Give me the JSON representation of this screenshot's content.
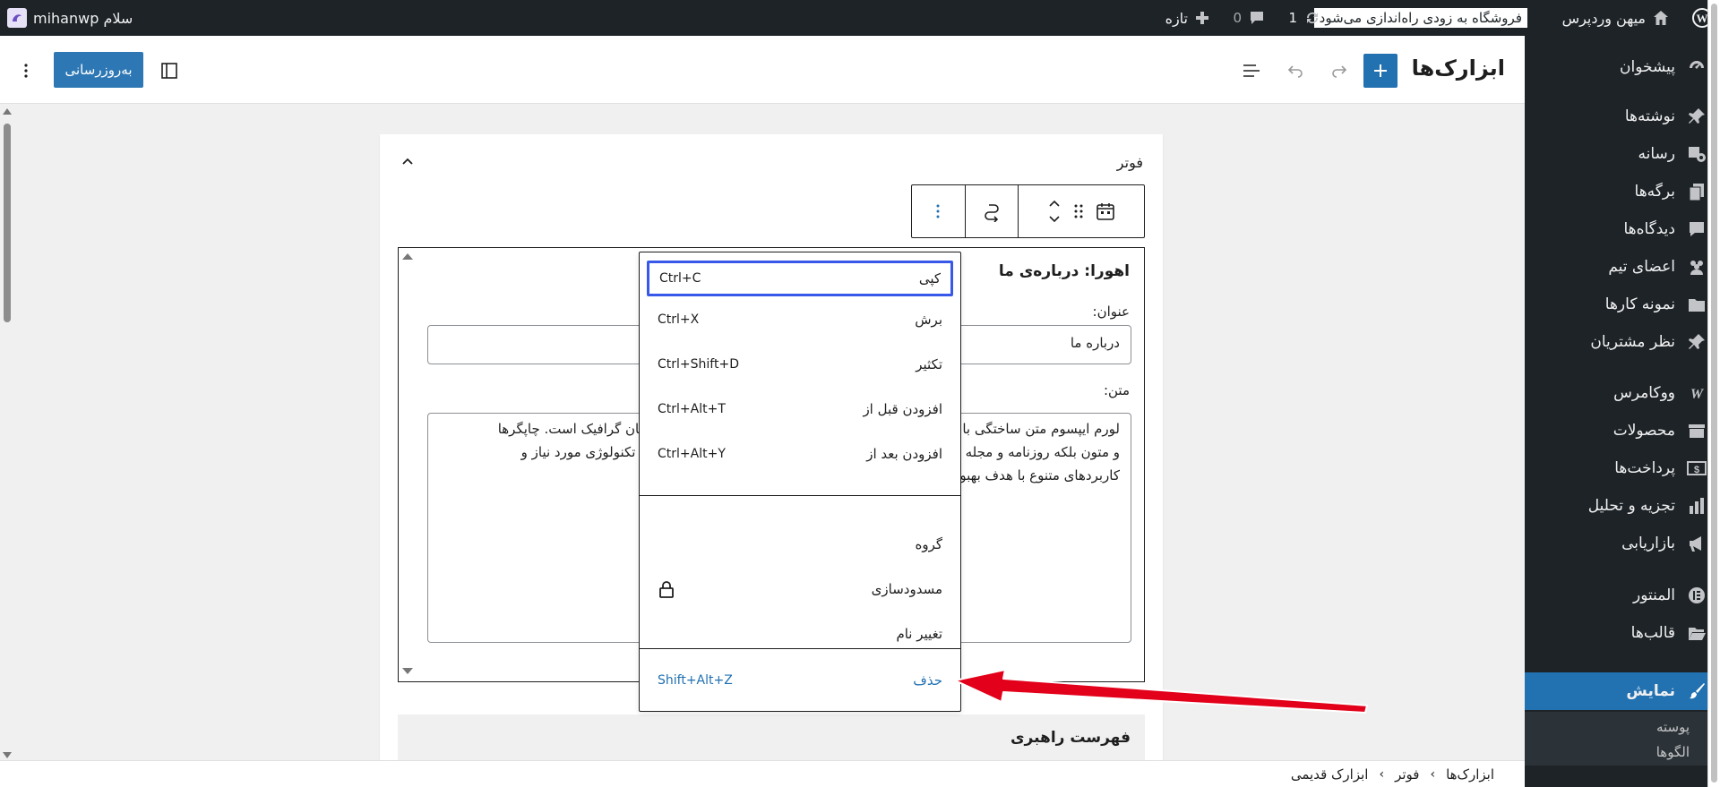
{
  "adminbar": {
    "greeting": "سلام mihanwp",
    "site_name": "میهن وردپرس",
    "store_notice": "فروشگاه به زودی راه‌اندازی می‌شود",
    "updates_count": "1",
    "comments_count": "0",
    "new_label": "تازه"
  },
  "sidebar": {
    "items": [
      {
        "label": "پیشخوان",
        "icon": "dashboard-icon"
      },
      {
        "label": "نوشته‌ها",
        "icon": "pin-icon"
      },
      {
        "label": "رسانه",
        "icon": "media-icon"
      },
      {
        "label": "برگه‌ها",
        "icon": "pages-icon"
      },
      {
        "label": "دیدگاه‌ها",
        "icon": "comment-icon"
      },
      {
        "label": "اعضای تیم",
        "icon": "team-icon"
      },
      {
        "label": "نمونه کارها",
        "icon": "folder-icon"
      },
      {
        "label": "نظر مشتریان",
        "icon": "pin-icon"
      },
      {
        "label": "ووکامرس",
        "icon": "woocommerce-icon"
      },
      {
        "label": "محصولات",
        "icon": "archive-icon"
      },
      {
        "label": "پرداخت‌ها",
        "icon": "dollar-icon"
      },
      {
        "label": "تجزیه و تحلیل",
        "icon": "chart-bar-icon"
      },
      {
        "label": "بازاریابی",
        "icon": "megaphone-icon"
      },
      {
        "label": "المنتور",
        "icon": "elementor-icon"
      },
      {
        "label": "قالب‌ها",
        "icon": "folder-open-icon"
      },
      {
        "label": "نمایش",
        "icon": "brush-icon"
      }
    ],
    "submenu": [
      "پوسته",
      "الگوها"
    ]
  },
  "header": {
    "title": "ابزارک‌ها",
    "update_label": "به‌روزرسانی"
  },
  "panel": {
    "area_title": "فوتر"
  },
  "widget": {
    "title": "اهورا: درباره‌ی ما",
    "title_label": "عنوان:",
    "title_value": "درباره ما",
    "text_label": "متن:",
    "text_value": "لورم ایپسوم متن ساختگی با تولید سادگی نامفهوم از صنعت چاپ و با استفاده از طراحان گرافیک است. چاپگرها\nو متون بلکه روزنامه و مجله در ستون و سطرآنچنان که لازم است و برای شرایط فعلی تکنولوژی مورد نیاز و\nکاربردهای متنوع با هدف بهبود ابزارهای کاربردی می باشد."
  },
  "block2": {
    "title": "فهرست راهبری"
  },
  "menu": {
    "items": [
      {
        "label": "کپی",
        "shortcut": "Ctrl+C"
      },
      {
        "label": "برش",
        "shortcut": "Ctrl+X"
      },
      {
        "label": "تکثیر",
        "shortcut": "Ctrl+Shift+D"
      },
      {
        "label": "افزودن قبل از",
        "shortcut": "Ctrl+Alt+T"
      },
      {
        "label": "افزودن بعد از",
        "shortcut": "Ctrl+Alt+Y"
      },
      {
        "label": "گروه",
        "shortcut": ""
      },
      {
        "label": "مسدودسازی",
        "shortcut": ""
      },
      {
        "label": "تغییر نام",
        "shortcut": ""
      },
      {
        "label": "حذف",
        "shortcut": "Shift+Alt+Z"
      }
    ]
  },
  "breadcrumb": [
    "ابزارک‌ها",
    "فوتر",
    "ابزارک قدیمی"
  ],
  "colors": {
    "accent": "#2271b1",
    "adminbar": "#1d2327",
    "annotation_arrow": "#e2001a"
  }
}
